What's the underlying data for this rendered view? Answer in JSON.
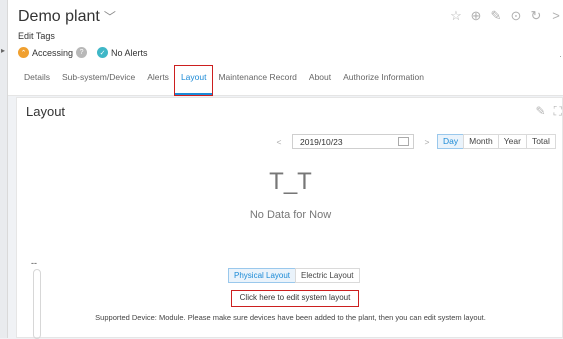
{
  "header": {
    "title": "Demo plant",
    "edit_tags": "Edit Tags",
    "status_accessing": "Accessing",
    "status_alerts": "No Alerts",
    "icon_help": "?",
    "icon_status_ok": "✓",
    "icon_status_accessing": "⌃",
    "tools": [
      "star-outline-icon",
      "plus-circle-icon",
      "edit-square-icon",
      "more-circle-icon",
      "refresh-icon",
      "chevron-right-icon"
    ]
  },
  "tabs": [
    {
      "label": "Details"
    },
    {
      "label": "Sub-system/Device"
    },
    {
      "label": "Alerts"
    },
    {
      "label": "Layout",
      "active": true
    },
    {
      "label": "Maintenance Record"
    },
    {
      "label": "About"
    },
    {
      "label": "Authorize Information"
    }
  ],
  "panel": {
    "title": "Layout",
    "date": "2019/10/23",
    "prev_arrow": "<",
    "next_arrow": ">",
    "periods": [
      "Day",
      "Month",
      "Year",
      "Total"
    ],
    "active_period": "Day",
    "emoticon": "T_T",
    "no_data": "No Data for Now",
    "dash": "--",
    "layout_tabs": [
      "Physical Layout",
      "Electric Layout"
    ],
    "edit_button": "Click here to edit system layout",
    "supported_text": "Supported Device: Module. Please make sure devices have been added to the plant, then you can edit system layout."
  },
  "colors": {
    "accent": "#1b8ad6",
    "highlight": "#cc1f1f",
    "status_orange": "#f0a030",
    "status_teal": "#3fb7c7"
  }
}
